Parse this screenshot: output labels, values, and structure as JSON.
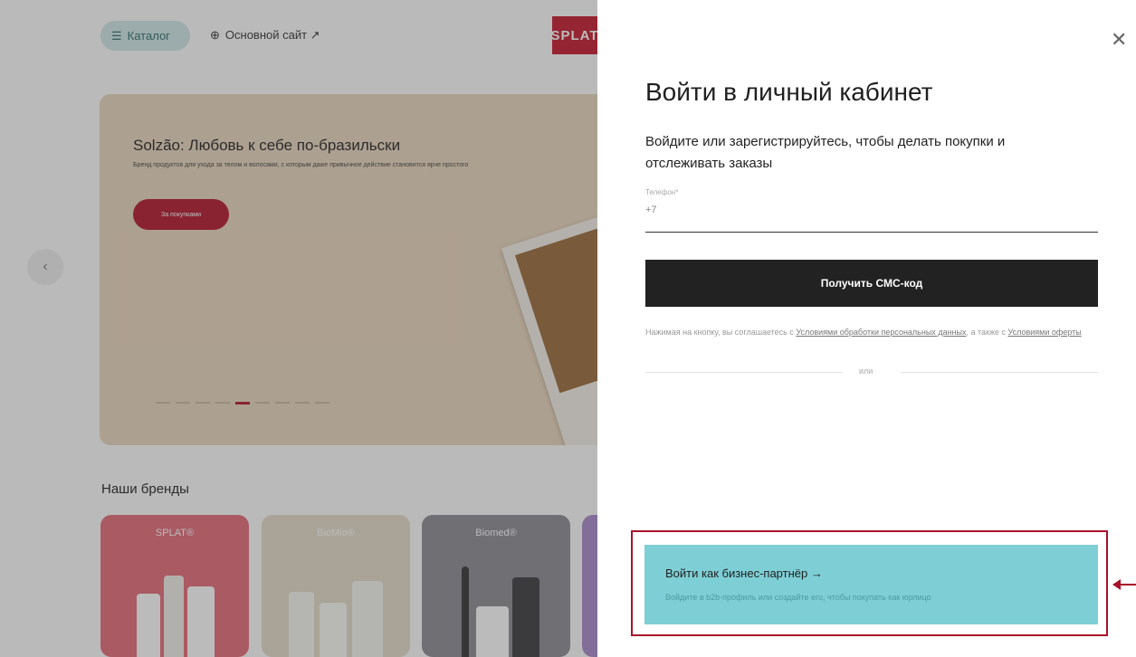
{
  "header": {
    "catalog_label": "Каталог",
    "site_link_label": "Основной сайт ↗",
    "logo_text": "SPLAT"
  },
  "banner": {
    "title": "Solzão: Любовь к себе по-бразильски",
    "text": "Бренд продуктов для ухода за телом и волосами, с которым даже привычное действие становится ярче простого",
    "button_label": "За покупками",
    "slide_count": 9,
    "active_slide": 5
  },
  "brands": {
    "title": "Наши бренды",
    "items": [
      {
        "name": "SPLAT®",
        "color": "#e8707d"
      },
      {
        "name": "BioMio®",
        "color": "#e2dcc9"
      },
      {
        "name": "Biomed®",
        "color": "#8c8c96"
      }
    ]
  },
  "login": {
    "title": "Войти в личный кабинет",
    "subtitle": "Войдите или зарегистрируйтесь, чтобы делать покупки и отслеживать заказы",
    "phone_label": "Телефон*",
    "phone_value": "+7",
    "sms_button": "Получить СМС-код",
    "terms_prefix": "Нажимая на кнопку, вы соглашаетесь с ",
    "terms_link1": "Условиями обработки персональных данных",
    "terms_middle": ", а также с ",
    "terms_link2": "Условиями оферты",
    "or_text": "или",
    "close_icon": "close-icon"
  },
  "b2b": {
    "title": "Войти как бизнес-партнёр →",
    "text": "Войдите в b2b-профиль или создайте его, чтобы покупать как юрлицо",
    "color": "#7ecfd5"
  },
  "highlight_color": "#a8122a"
}
